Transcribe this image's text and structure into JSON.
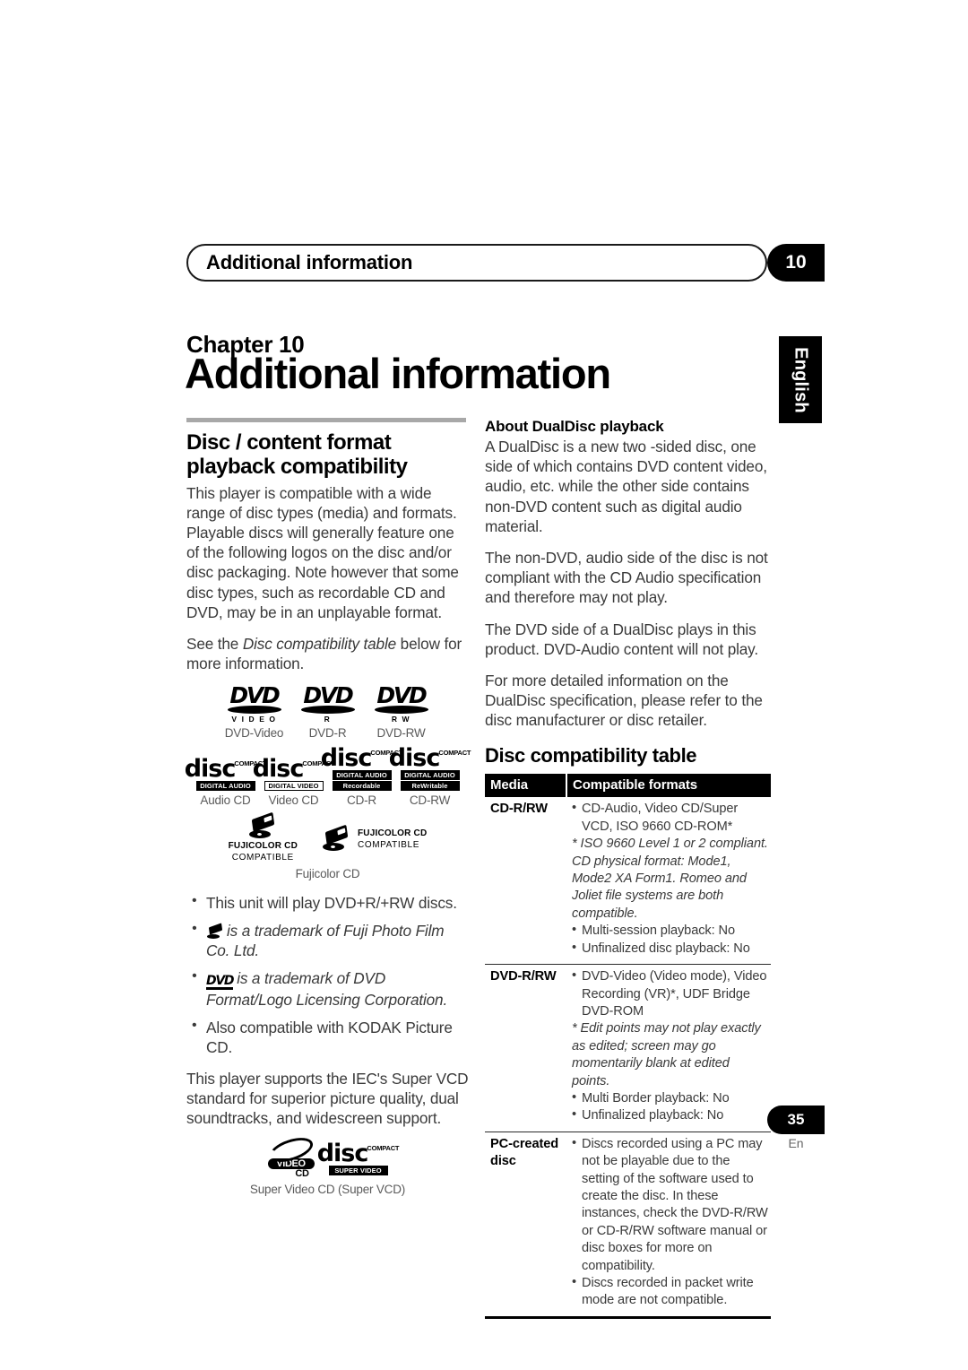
{
  "running_header": {
    "title": "Additional information",
    "chapter_number": "10"
  },
  "side_tab": {
    "language": "English"
  },
  "chapter": {
    "label": "Chapter 10",
    "title": "Additional information"
  },
  "left_column": {
    "section_title": "Disc / content format playback compatibility",
    "paragraphs": [
      "This player is compatible with a wide range of disc types (media) and formats. Playable discs will generally feature one of the following logos on the disc and/or disc packaging. Note however that some disc types, such as recordable CD and DVD, may be in an unplayable format.",
      "See the Disc compatibility table below for more information."
    ],
    "see_also": {
      "prefix": "See the ",
      "italic": "Disc compatibility table",
      "suffix": " below for more information."
    },
    "dvd_logos": [
      {
        "mark": "DVD",
        "sub": "V I D E O",
        "caption": "DVD-Video"
      },
      {
        "mark": "DVD",
        "sub": "R",
        "caption": "DVD-R"
      },
      {
        "mark": "DVD",
        "sub": "R W",
        "caption": "DVD-RW"
      }
    ],
    "cd_logos": [
      {
        "top": "COMPACT",
        "word": "disc",
        "band": "DIGITAL AUDIO",
        "band_style": "inv",
        "caption": "Audio CD"
      },
      {
        "top": "COMPACT",
        "word": "disc",
        "band": "DIGITAL VIDEO",
        "band_style": "box",
        "caption": "Video CD"
      },
      {
        "top": "COMPACT",
        "word": "disc",
        "band": "DIGITAL AUDIO",
        "band2": "Recordable",
        "band_style": "inv",
        "caption": "CD-R"
      },
      {
        "top": "COMPACT",
        "word": "disc",
        "band": "DIGITAL AUDIO",
        "band2": "ReWritable",
        "band_style": "inv",
        "caption": "CD-RW"
      }
    ],
    "fujicolor": {
      "line1": "FUJICOLOR CD",
      "line2": "COMPATIBLE",
      "caption": "Fujicolor CD"
    },
    "bullets": [
      {
        "text": "This unit will play DVD+R/+RW discs.",
        "icon": "none",
        "italic": false
      },
      {
        "text": "is a trademark of Fuji Photo Film Co. Ltd.",
        "icon": "fujicolor-icon",
        "italic": true
      },
      {
        "text": "is a trademark of DVD Format/Logo Licensing Corporation.",
        "icon": "dvd-icon",
        "italic": true
      },
      {
        "text": "Also compatible with KODAK Picture CD.",
        "icon": "none",
        "italic": false
      }
    ],
    "svcd_paragraph": "This player supports the IEC's Super VCD standard for superior picture quality, dual soundtracks, and widescreen support.",
    "svcd_logos": {
      "video_cd": {
        "line1": "VIDEO",
        "line2": "CD"
      },
      "compact_disc": {
        "top": "COMPACT",
        "word": "disc",
        "band": "SUPER VIDEO"
      },
      "caption": "Super Video CD (Super VCD)"
    }
  },
  "right_column": {
    "dualdisc": {
      "heading": "About DualDisc playback",
      "paragraphs": [
        "A DualDisc is a new two -sided disc, one side of which contains DVD content video, audio, etc. while the other side contains non-DVD content such as digital audio material.",
        "The non-DVD, audio side of the disc is not compliant with the CD Audio specification and therefore may not play.",
        "The DVD side of a DualDisc plays in this product. DVD-Audio content will not play.",
        "For more detailed information on the DualDisc specification, please refer to the disc manufacturer or disc retailer."
      ]
    },
    "table": {
      "title": "Disc compatibility table",
      "headers": [
        "Media",
        "Compatible formats"
      ],
      "rows": [
        {
          "media": "CD-R/RW",
          "lines": [
            {
              "type": "bullet",
              "text": "CD-Audio, Video CD/Super VCD, ISO 9660 CD-ROM*"
            },
            {
              "type": "note",
              "text": "* ISO 9660 Level 1 or 2 compliant. CD physical format: Mode1, Mode2 XA Form1. Romeo and Joliet file systems are both compatible."
            },
            {
              "type": "bullet",
              "text": "Multi-session playback: No"
            },
            {
              "type": "bullet",
              "text": "Unfinalized disc playback: No"
            }
          ]
        },
        {
          "media": "DVD-R/RW",
          "lines": [
            {
              "type": "bullet",
              "text": "DVD-Video (Video mode), Video Recording (VR)*, UDF Bridge DVD-ROM"
            },
            {
              "type": "note",
              "text": "* Edit points may not play exactly as edited; screen may go momentarily blank at edited points."
            },
            {
              "type": "bullet",
              "text": "Multi Border playback: No"
            },
            {
              "type": "bullet",
              "text": "Unfinalized playback: No"
            }
          ]
        },
        {
          "media": "PC-created disc",
          "lines": [
            {
              "type": "bullet",
              "text": "Discs recorded using a PC may not be playable due to the setting of the software used to create the disc. In these instances, check the DVD-R/RW or CD-R/RW software manual or disc boxes for more on compatibility."
            },
            {
              "type": "bullet",
              "text": "Discs recorded in packet write mode are not compatible."
            }
          ]
        }
      ]
    }
  },
  "footer": {
    "page_number": "35",
    "language_code": "En"
  }
}
